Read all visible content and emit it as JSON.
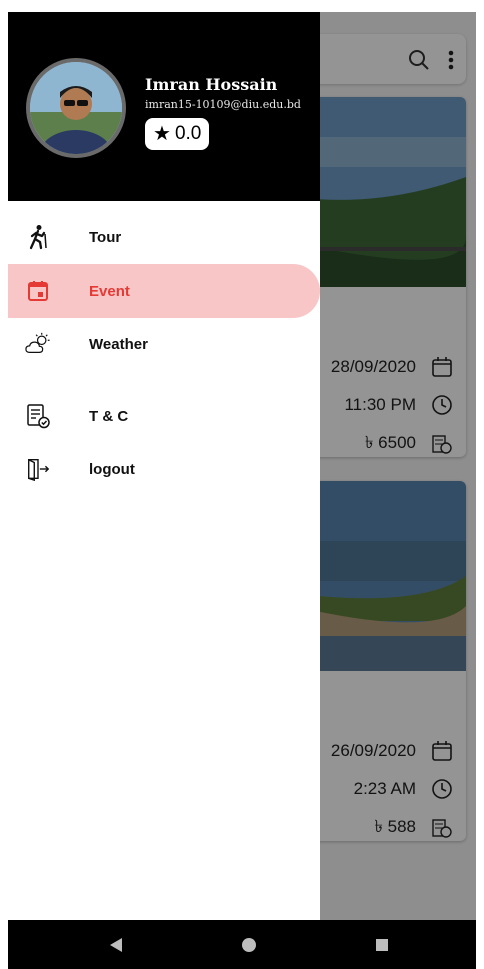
{
  "drawer": {
    "user_name": "Imran Hossain",
    "user_email": "imran15-10109@diu.edu.bd",
    "rating": "0.0",
    "items": [
      {
        "label": "Tour",
        "icon": "hiking-icon",
        "active": false
      },
      {
        "label": "Event",
        "icon": "calendar-icon",
        "active": true
      },
      {
        "label": "Weather",
        "icon": "partly-cloudy-icon",
        "active": false
      },
      {
        "label": "T & C",
        "icon": "terms-document-icon",
        "active": false
      },
      {
        "label": "logout",
        "icon": "logout-icon",
        "active": false
      }
    ]
  },
  "background": {
    "cards": [
      {
        "date": "28/09/2020",
        "time": "11:30 PM",
        "cost": "৳ 6500"
      },
      {
        "date": "26/09/2020",
        "time": "2:23 AM",
        "cost": "৳ 588"
      }
    ]
  },
  "colors": {
    "accent": "#e53935",
    "active_bg": "#f8c6c6",
    "header_bg": "#000000"
  }
}
